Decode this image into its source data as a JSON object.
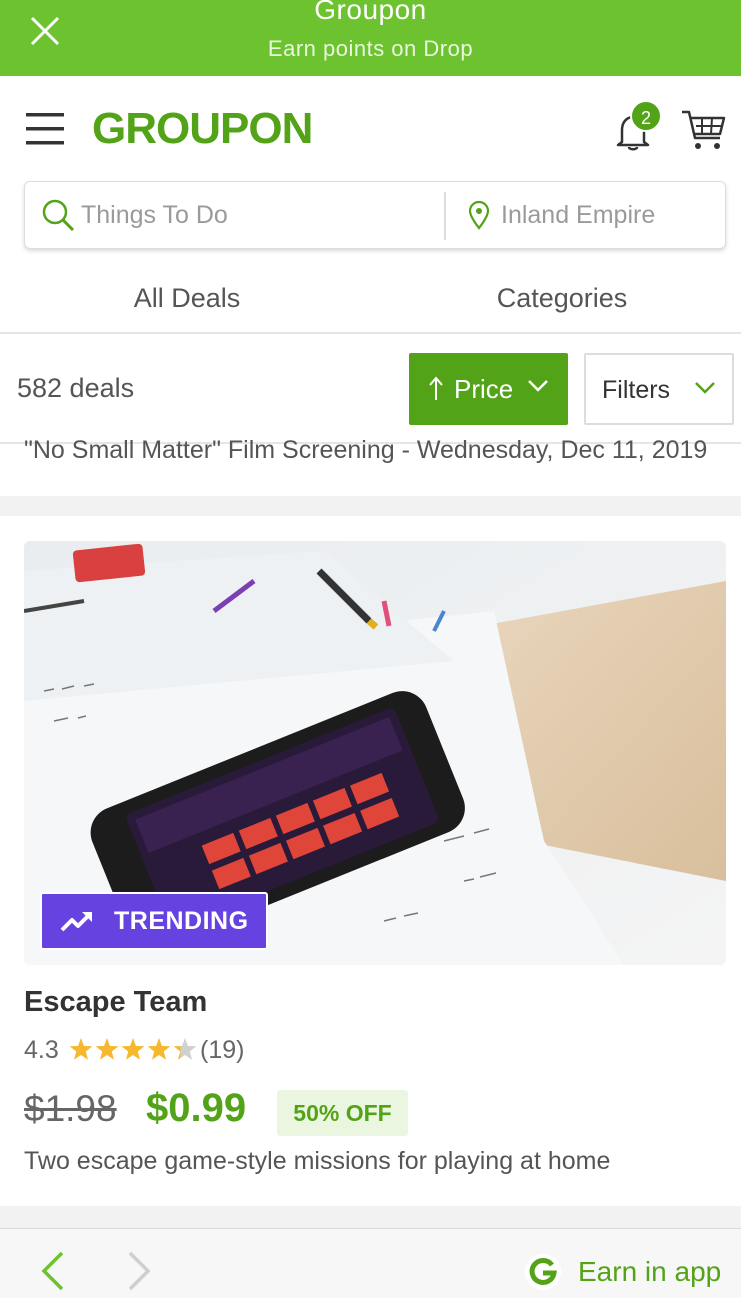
{
  "banner": {
    "title": "Groupon",
    "subtitle": "Earn points on Drop"
  },
  "header": {
    "logo": "GROUPON",
    "notification_count": "2"
  },
  "search": {
    "what_placeholder": "Things To Do",
    "where_placeholder": "Inland Empire"
  },
  "tabs": [
    {
      "label": "All Deals"
    },
    {
      "label": "Categories"
    }
  ],
  "sortbar": {
    "deal_count": "582 deals",
    "sort_label": "Price",
    "filters_label": "Filters"
  },
  "previous_deal": {
    "title": "\"No Small Matter\" Film Screening - Wednesday, Dec 11, 2019"
  },
  "deal": {
    "badge": "TRENDING",
    "title": "Escape Team",
    "rating": "4.3",
    "rating_value": 4.3,
    "rating_max": 5,
    "review_count": "(19)",
    "original_price": "$1.98",
    "price": "$0.99",
    "discount": "50% OFF",
    "description": "Two escape game-style missions for playing at home"
  },
  "bottombar": {
    "earn_label": "Earn in app"
  },
  "colors": {
    "brand_green": "#53a318",
    "banner_green": "#6cc32f",
    "trending_purple": "#6642e0",
    "star_gold": "#f5b82e"
  }
}
